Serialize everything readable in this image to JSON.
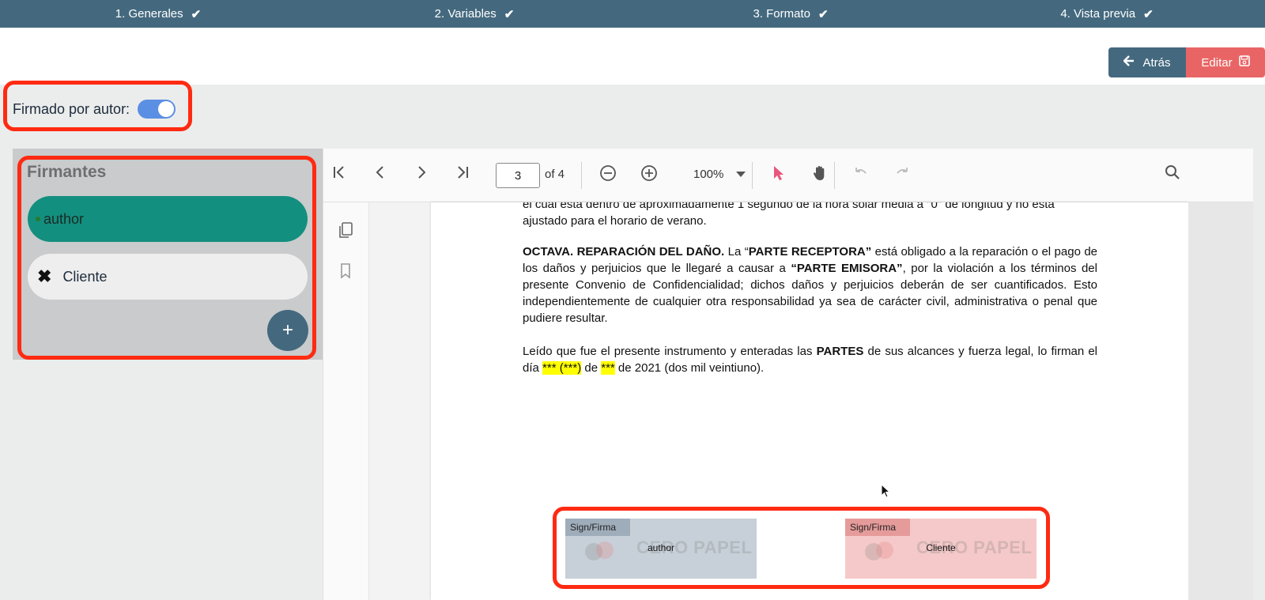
{
  "stepper": {
    "steps": [
      {
        "label": "1. Generales"
      },
      {
        "label": "2. Variables"
      },
      {
        "label": "3. Formato"
      },
      {
        "label": "4. Vista previa"
      }
    ]
  },
  "actions": {
    "back_label": "Atrás",
    "edit_label": "Editar"
  },
  "signed_by_author": {
    "label": "Firmado por autor:",
    "enabled": true
  },
  "signers_panel": {
    "title": "Firmantes",
    "signers": [
      {
        "name": "author"
      },
      {
        "name": "Cliente"
      }
    ],
    "add_label": "+"
  },
  "viewer": {
    "current_page": "3",
    "of_total": "of 4",
    "zoom": "100%",
    "doc": {
      "line_top": "el cual está dentro de aproximadamente 1 segundo de la hora solar media a \"0\" de longitud y no está",
      "line_top2": "ajustado para el horario de verano.",
      "clause_title": "OCTAVA. REPARACIÓN DEL DAÑO.",
      "clause_p1": " La “",
      "clause_b1": "PARTE RECEPTORA”",
      "clause_p2": " está obligado a la reparación o el pago de los daños y perjuicios que le llegaré a causar a ",
      "clause_b2": "“PARTE EMISORA”",
      "clause_p3": ", por la violación a los términos del presente Convenio de Confidencialidad; dichos daños y perjuicios deberán de ser cuantificados. Esto independientemente de cualquier otra responsabilidad ya sea de carácter civil, administrativa o penal que pudiere resultar.",
      "closing_p1": "Leído que fue el presente instrumento y enteradas las ",
      "closing_b1": "PARTES",
      "closing_p2": " de sus alcances y fuerza legal, lo firman el día ",
      "closing_h1": "*** (***)",
      "closing_p3": " de ",
      "closing_h2": "***",
      "closing_p4": " de 2021 (dos mil veintiuno)."
    },
    "signature_fields": [
      {
        "tag": "Sign/Firma",
        "name": "author",
        "watermark": "CERO PAPEL"
      },
      {
        "tag": "Sign/Firma",
        "name": "Cliente",
        "watermark": "CERO PAPEL"
      }
    ]
  }
}
